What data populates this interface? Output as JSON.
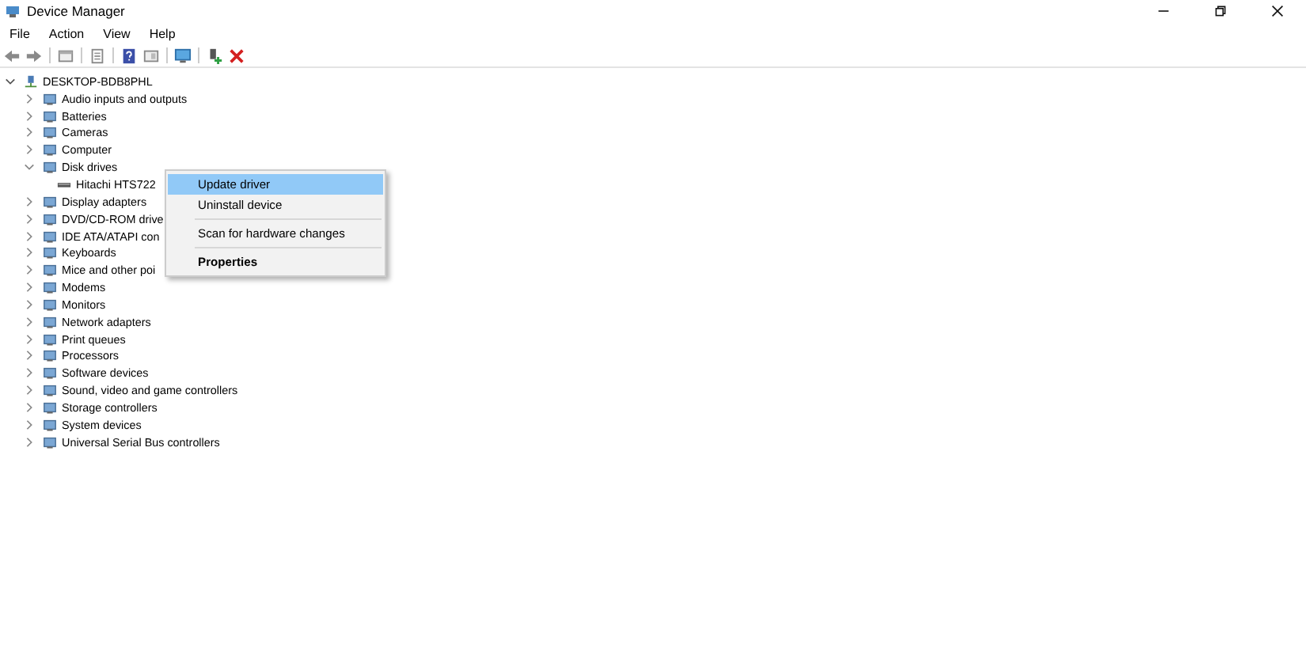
{
  "window": {
    "title": "Device Manager"
  },
  "menu": [
    "File",
    "Action",
    "View",
    "Help"
  ],
  "tree": {
    "label": "DESKTOP-BDB8PHL",
    "expanded": true,
    "children": [
      {
        "label": "Audio inputs and outputs",
        "expanded": false
      },
      {
        "label": "Batteries",
        "expanded": false
      },
      {
        "label": "Cameras",
        "expanded": false
      },
      {
        "label": "Computer",
        "expanded": false
      },
      {
        "label": "Disk drives",
        "expanded": true,
        "children": [
          {
            "label": "Hitachi HTS722"
          }
        ]
      },
      {
        "label": "Display adapters",
        "expanded": false
      },
      {
        "label": "DVD/CD-ROM drive",
        "expanded": false
      },
      {
        "label": "IDE ATA/ATAPI con",
        "expanded": false
      },
      {
        "label": "Keyboards",
        "expanded": false
      },
      {
        "label": "Mice and other poi",
        "expanded": false
      },
      {
        "label": "Modems",
        "expanded": false
      },
      {
        "label": "Monitors",
        "expanded": false
      },
      {
        "label": "Network adapters",
        "expanded": false
      },
      {
        "label": "Print queues",
        "expanded": false
      },
      {
        "label": "Processors",
        "expanded": false
      },
      {
        "label": "Software devices",
        "expanded": false
      },
      {
        "label": "Sound, video and game controllers",
        "expanded": false
      },
      {
        "label": "Storage controllers",
        "expanded": false
      },
      {
        "label": "System devices",
        "expanded": false
      },
      {
        "label": "Universal Serial Bus controllers",
        "expanded": false
      }
    ]
  },
  "context_menu": [
    {
      "label": "Update driver",
      "selected": true,
      "bold": false,
      "separator_after": false
    },
    {
      "label": "Uninstall device",
      "selected": false,
      "bold": false,
      "separator_after": true
    },
    {
      "label": "Scan for hardware changes",
      "selected": false,
      "bold": false,
      "separator_after": true
    },
    {
      "label": "Properties",
      "selected": false,
      "bold": true,
      "separator_after": false
    }
  ]
}
